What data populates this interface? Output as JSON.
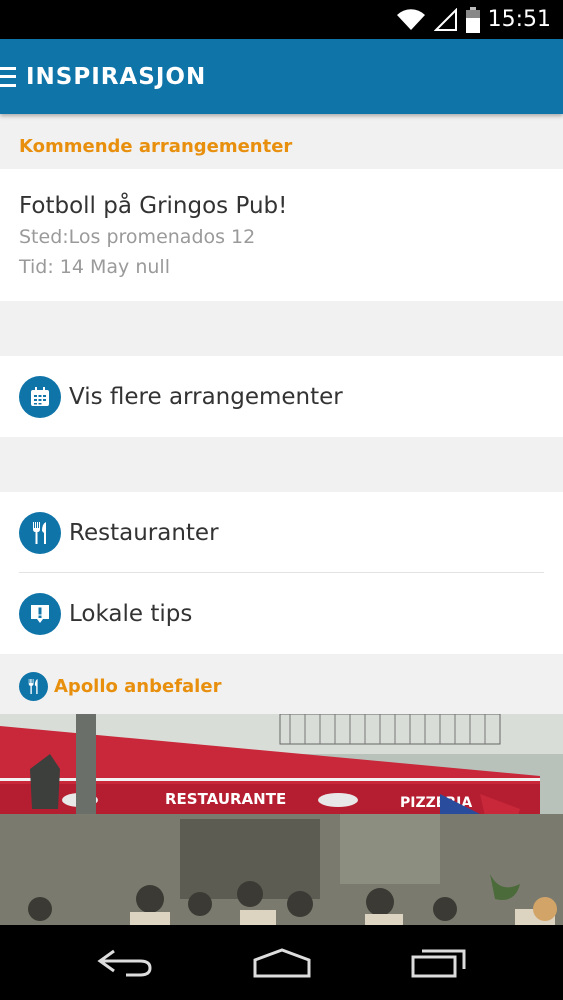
{
  "status_bar": {
    "time": "15:51",
    "icons": [
      "wifi-icon",
      "signal-icon",
      "battery-icon"
    ]
  },
  "app_bar": {
    "title": "INSPIRASJON",
    "menu_icon": "hamburger-menu-icon"
  },
  "upcoming": {
    "header": "Kommende arrangementer",
    "event": {
      "title": "Fotboll på Gringos Pub!",
      "place": "Sted:Los promenados 12",
      "time": "Tid: 14 May null"
    }
  },
  "more_events": {
    "label": "Vis flere arrangementer",
    "icon": "calendar-icon"
  },
  "menu_items": [
    {
      "label": "Restauranter",
      "icon": "fork-knife-icon"
    },
    {
      "label": "Lokale tips",
      "icon": "exclamation-speech-icon"
    }
  ],
  "recommend": {
    "header": "Apollo anbefaler",
    "icon": "fork-knife-icon"
  },
  "photo": {
    "awning_left": "RESTAURANTE",
    "awning_right": "PIZZERIA"
  },
  "nav_bar": {
    "buttons": [
      "back-icon",
      "home-icon",
      "recents-icon"
    ]
  },
  "colors": {
    "brand_blue": "#0f74a8",
    "accent_orange": "#e8900e",
    "awning_red": "#c8283a"
  }
}
